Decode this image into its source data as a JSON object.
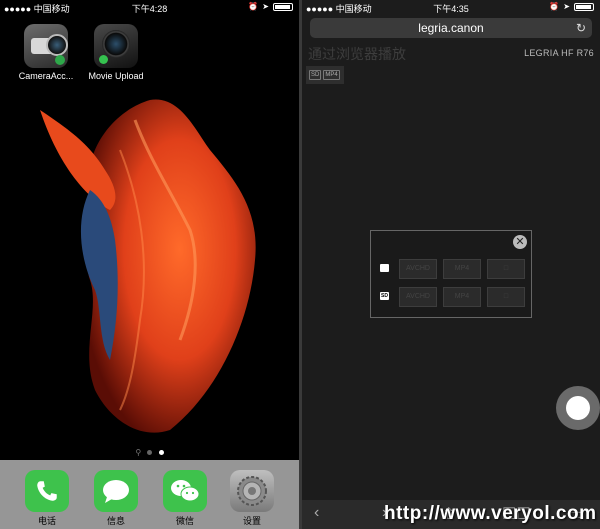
{
  "left": {
    "status": {
      "carrier": "●●●●● 中国移动",
      "time": "下午4:28"
    },
    "apps": [
      {
        "label": "CameraAcc...",
        "icon": "camera-access-icon"
      },
      {
        "label": "Movie Upload",
        "icon": "movie-upload-icon"
      }
    ],
    "dock": [
      {
        "label": "电话",
        "icon": "phone-icon"
      },
      {
        "label": "信息",
        "icon": "messages-icon"
      },
      {
        "label": "微信",
        "icon": "wechat-icon"
      },
      {
        "label": "设置",
        "icon": "settings-icon"
      }
    ],
    "page_indicator": {
      "pages": 2,
      "current": 2
    }
  },
  "right": {
    "status": {
      "carrier": "●●●●● 中国移动",
      "time": "下午4:35"
    },
    "browser": {
      "url": "legria.canon",
      "reload_glyph": "↻",
      "page_title": "通过浏览器播放",
      "model": "LEGRIA HF R76",
      "tags": [
        "SD",
        "MP4"
      ]
    },
    "dialog": {
      "close_glyph": "✕",
      "rows": [
        {
          "media_icon": "internal-memory-icon",
          "media_label": "",
          "buttons": [
            "AVCHD",
            "MP4",
            "□"
          ]
        },
        {
          "media_icon": "sd-card-icon",
          "media_label": "SD",
          "buttons": [
            "AVCHD",
            "MP4",
            "□"
          ]
        }
      ]
    },
    "toolbar": {
      "back": "‹",
      "forward": "›",
      "share": "⇧",
      "bookmarks": "☐☐",
      "tabs": "▭"
    }
  },
  "watermark": "http://www.veryol.com"
}
